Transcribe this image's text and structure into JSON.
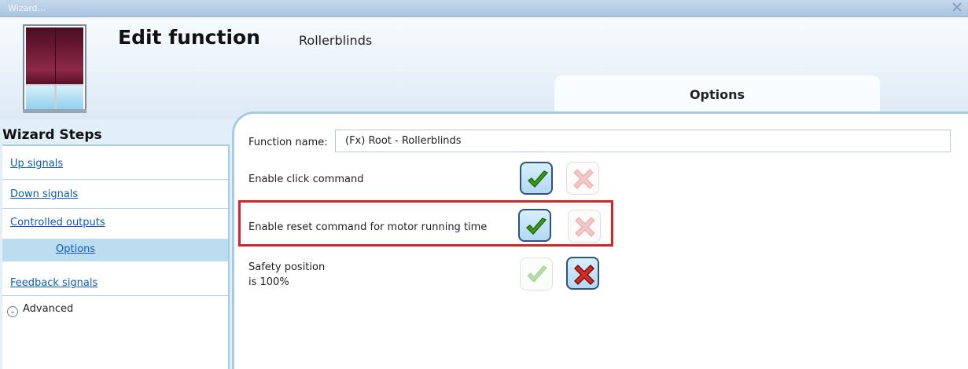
{
  "window": {
    "title": "Wizard...",
    "close_icon": "close-icon"
  },
  "header": {
    "heading": "Edit function",
    "function_type": "Rollerblinds",
    "logo_icon": "rollerblind-window-icon"
  },
  "tabs": [
    {
      "label": "Options",
      "active": true
    }
  ],
  "wizard_steps": {
    "title": "Wizard Steps",
    "items": [
      {
        "label": "Up signals",
        "active": false
      },
      {
        "label": "Down signals",
        "active": false
      },
      {
        "label": "Controlled outputs",
        "active": false
      },
      {
        "label": "Options",
        "active": true
      },
      {
        "label": "Feedback signals",
        "active": false
      }
    ],
    "advanced": {
      "label": "Advanced",
      "icon": "chevron-down-icon"
    }
  },
  "options": {
    "function_name": {
      "label": "Function name:",
      "value": "(Fx) Root - Rollerblinds"
    },
    "rows": [
      {
        "label": "Enable click command",
        "checked": true,
        "highlighted": false
      },
      {
        "label": "Enable reset command for motor running time",
        "checked": true,
        "highlighted": true
      },
      {
        "label_line1": "Safety position",
        "label_line2": "is 100%",
        "checked": false,
        "highlighted": false
      }
    ]
  },
  "colors": {
    "accent_blue": "#a6cce4",
    "link": "#0d5ab7",
    "highlight_box": "#d8232a",
    "check_green": "#3d9a1e",
    "cross_red": "#d42a2a"
  }
}
